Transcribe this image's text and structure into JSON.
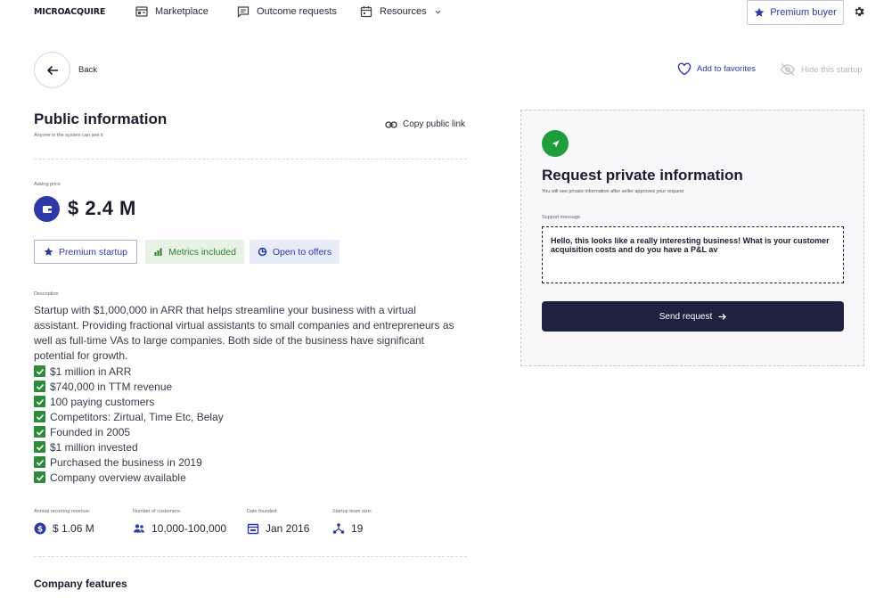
{
  "nav": {
    "logo": "MICROACQUIRE",
    "items": [
      {
        "label": "Marketplace",
        "icon": "marketplace-icon"
      },
      {
        "label": "Outcome requests",
        "icon": "message-icon"
      },
      {
        "label": "Resources",
        "icon": "calendar-icon"
      }
    ],
    "premium_buyer": "Premium buyer"
  },
  "back": {
    "label": "Back"
  },
  "actions": {
    "favorites": "Add to favorites",
    "hide": "Hide this startup"
  },
  "public_info": {
    "title": "Public information",
    "subtitle": "Anyone in the system can see it",
    "copy_link": "Copy public link",
    "asking_price_label": "Asking price",
    "asking_price": "$ 2.4 M",
    "badges": {
      "premium": "Premium startup",
      "metrics": "Metrics included",
      "offers": "Open to offers"
    },
    "description_label": "Description",
    "description": "Startup with $1,000,000 in ARR that helps streamline your business with a virtual assistant. Providing fractional virtual assistants to small companies and entrepreneurs as well as full-time VAs to large companies. Both side of the business have significant potential for growth.",
    "highlights": [
      "$1 million in ARR",
      "$740,000 in TTM revenue",
      "100 paying customers",
      "Competitors: Zirtual, Time Etc, Belay",
      "Founded in 2005",
      "$1 million invested",
      "Purchased the business in 2019",
      "Company overview available"
    ],
    "stats": [
      {
        "label": "Annual recurring revenue:",
        "value": "$ 1.06 M",
        "icon": "dollar-icon"
      },
      {
        "label": "Number of customers:",
        "value": "10,000-100,000",
        "icon": "users-icon"
      },
      {
        "label": "Date founded:",
        "value": "Jan 2016",
        "icon": "calendar-icon"
      },
      {
        "label": "Startup team size:",
        "value": "19",
        "icon": "team-icon"
      }
    ],
    "company_features": "Company features"
  },
  "private_request": {
    "title": "Request private information",
    "subtitle": "You will see private information after seller approves your request",
    "support_label": "Support message",
    "message": "Hello, this looks like a really interesting business! What is your customer acquisition costs and do you have a P&L av",
    "send_label": "Send request"
  },
  "colors": {
    "accent": "#2c3aa8",
    "dark_button": "#1e2142",
    "green": "#1e9e3a",
    "check_green": "#2e8b3a"
  }
}
